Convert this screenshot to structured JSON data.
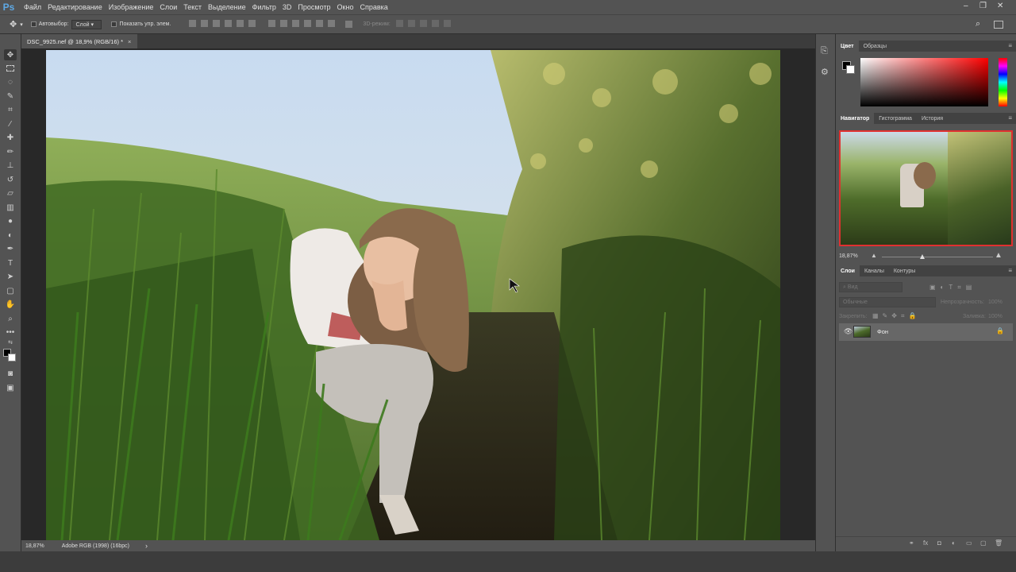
{
  "app": {
    "logo": "Ps"
  },
  "menu": [
    "Файл",
    "Редактирование",
    "Изображение",
    "Слои",
    "Текст",
    "Выделение",
    "Фильтр",
    "3D",
    "Просмотр",
    "Окно",
    "Справка"
  ],
  "window_controls": {
    "minimize": "–",
    "restore": "❐",
    "close": "✕"
  },
  "options": {
    "autoselect_label": "Автовыбор:",
    "autoselect_value": "Слой",
    "show_controls_label": "Показать упр. элем.",
    "mode_3d": "3D-режим:"
  },
  "document": {
    "tab_title": "DSC_9925.nef @ 18,9% (RGB/16) *",
    "tab_close": "×"
  },
  "status": {
    "zoom": "18,87%",
    "profile": "Adobe RGB (1998) (16bpc)",
    "arrow": "›"
  },
  "color_panel": {
    "tabs": [
      "Цвет",
      "Образцы"
    ],
    "active": 0
  },
  "navigator_panel": {
    "tabs": [
      "Навигатор",
      "Гистограмма",
      "История"
    ],
    "active": 0,
    "zoom": "18,87%"
  },
  "layers_panel": {
    "tabs": [
      "Слои",
      "Каналы",
      "Контуры"
    ],
    "active": 0,
    "search_placeholder": "Вид",
    "blend_mode": "Обычные",
    "opacity_label": "Непрозрачность:",
    "opacity_value": "100%",
    "lock_label": "Закрепить:",
    "fill_label": "Заливка:",
    "fill_value": "100%",
    "layers": [
      {
        "name": "Фон"
      }
    ]
  },
  "colors": {
    "accent": "#e03030",
    "ui_bg": "#535353",
    "canvas_bg": "#282828"
  }
}
